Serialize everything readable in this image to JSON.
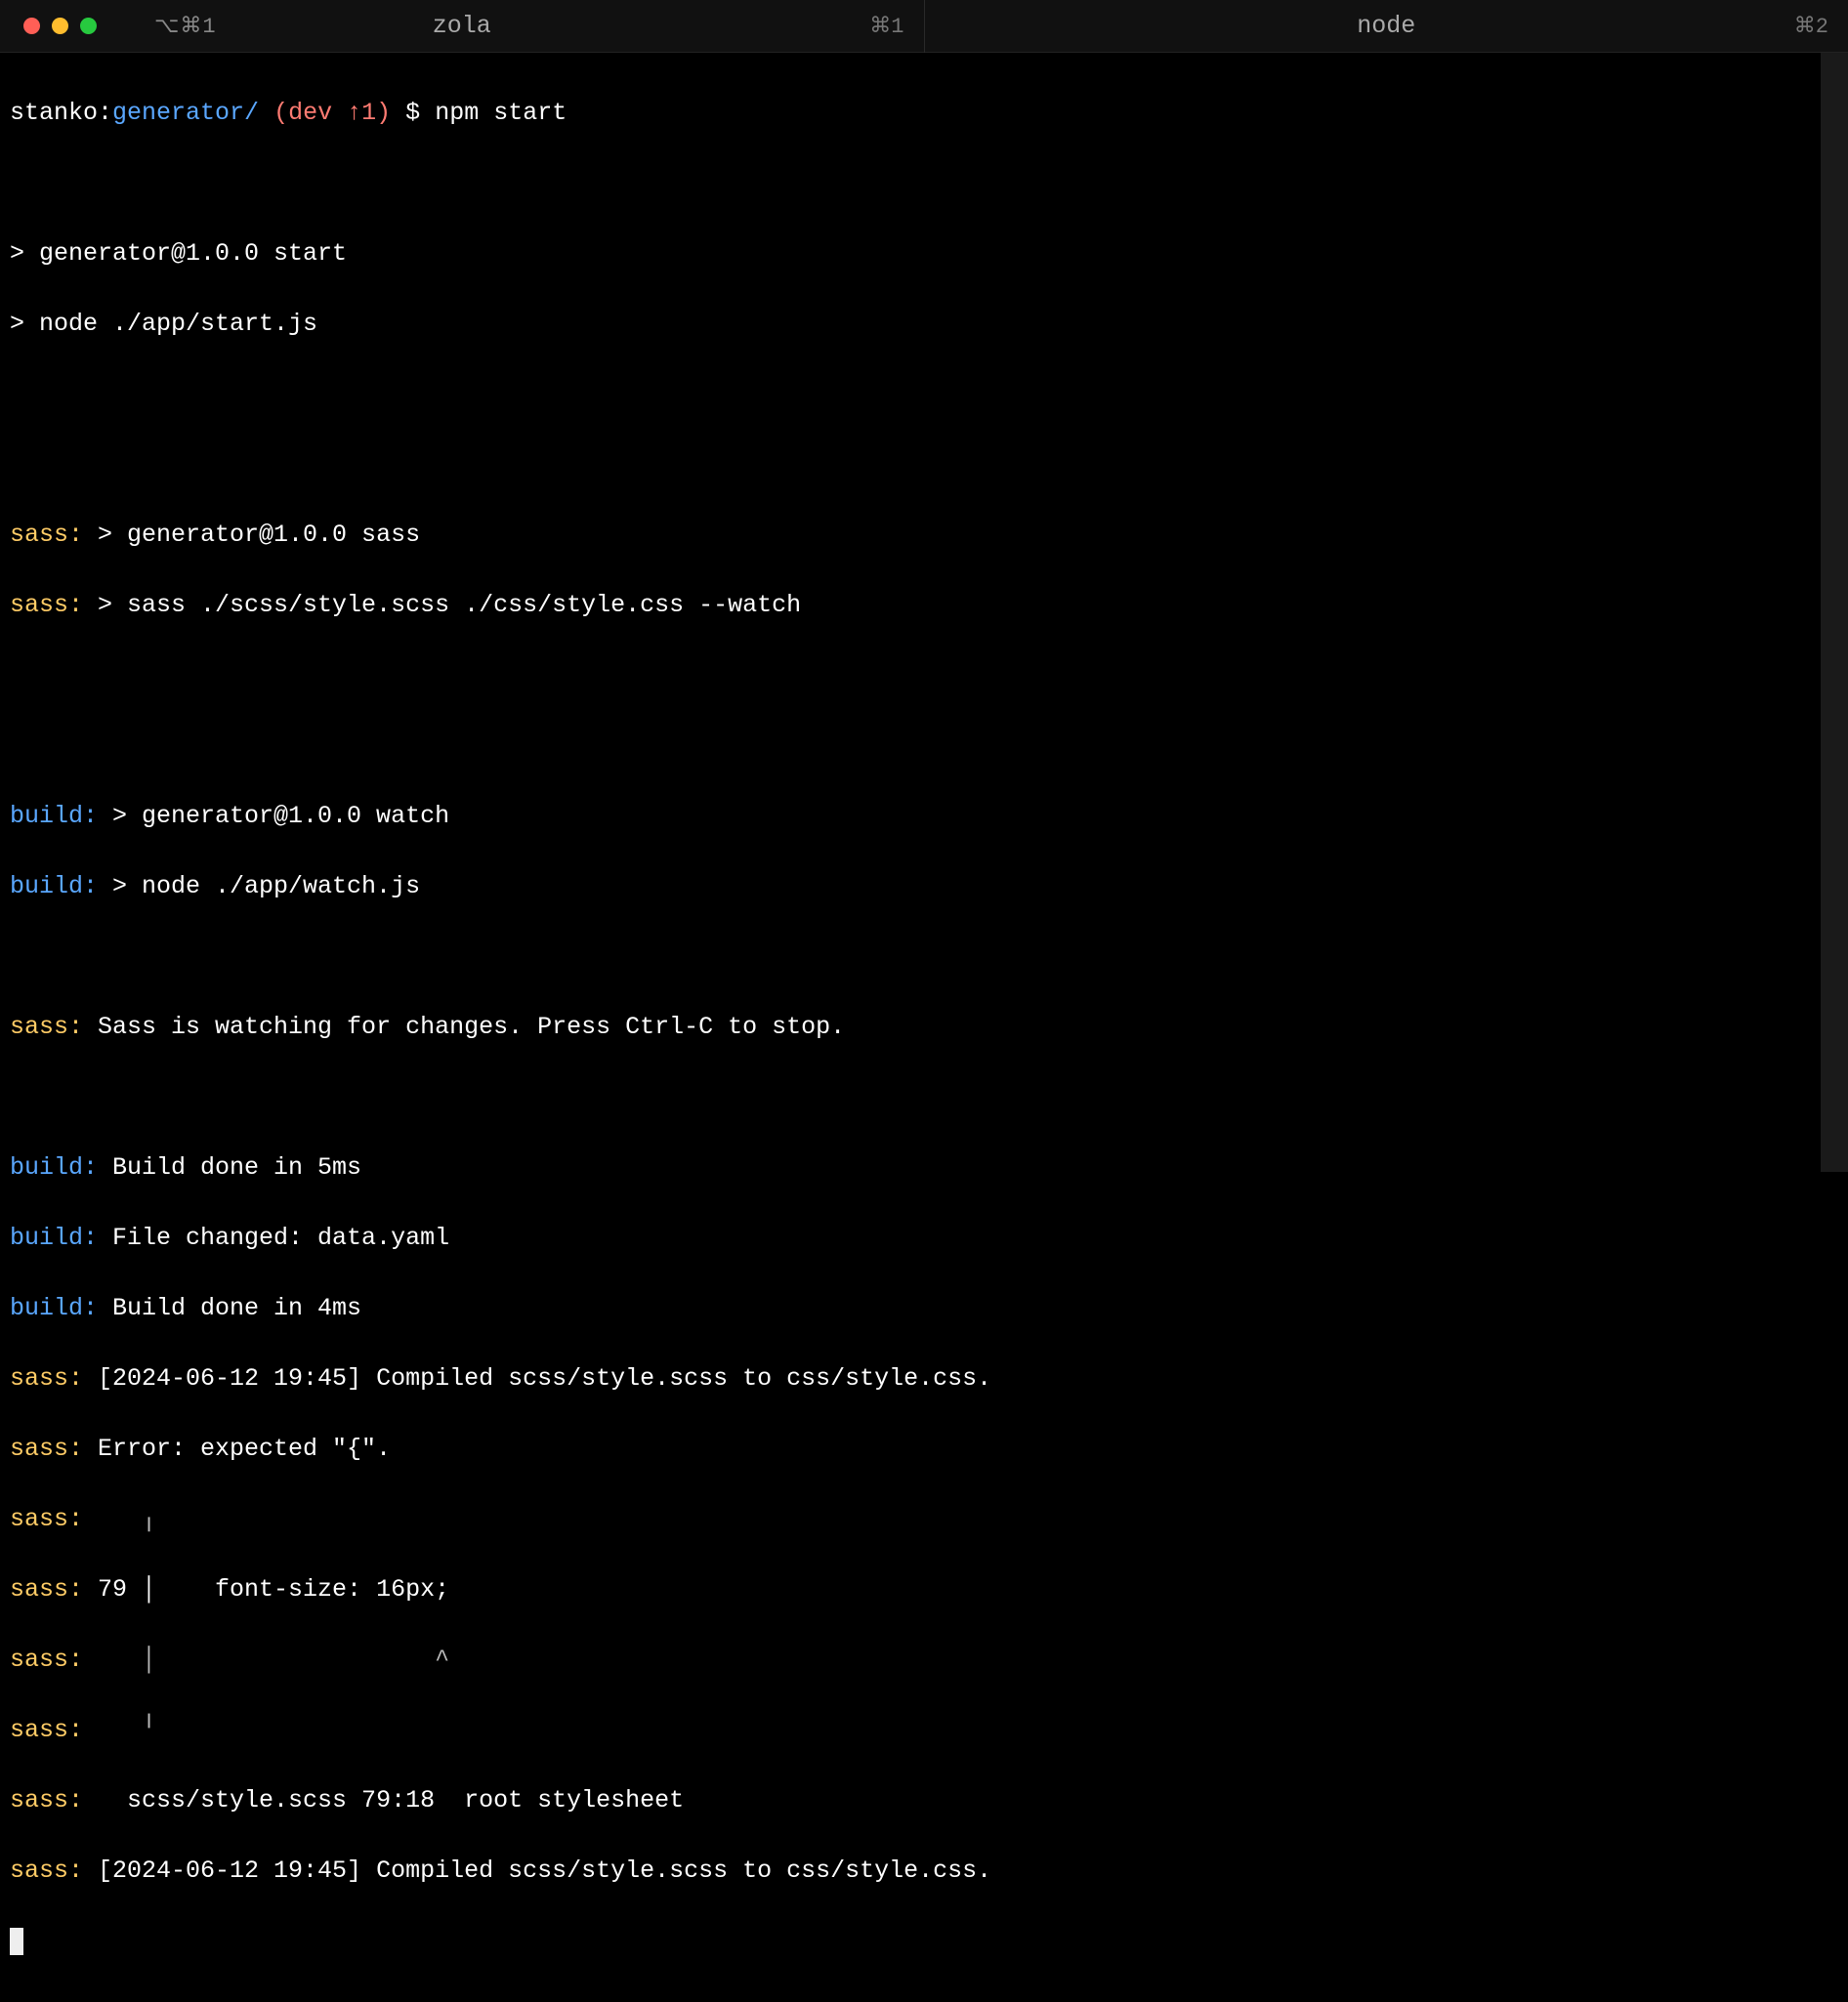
{
  "titlebar": {
    "broadcast_hint": "⌥⌘1",
    "tabs": [
      {
        "label": "zola",
        "shortcut": "⌘1"
      },
      {
        "label": "node",
        "shortcut": "⌘2"
      }
    ]
  },
  "prompt": {
    "user": "stanko",
    "cwd": "generator/",
    "branch": "dev",
    "ahead": "↑1",
    "dollar": "$",
    "command": "npm start"
  },
  "lines": {
    "npm1": "> generator@1.0.0 start",
    "npm2": "> node ./app/start.js",
    "sass_label": "sass:",
    "build_label": "build:",
    "sass1": " > generator@1.0.0 sass",
    "sass2": " > sass ./scss/style.scss ./css/style.css --watch",
    "build1": " > generator@1.0.0 watch",
    "build2": " > node ./app/watch.js",
    "sass_watch": " Sass is watching for changes. Press Ctrl-C to stop.",
    "build_done1": " Build done in 5ms",
    "build_changed": " File changed: data.yaml",
    "build_done2": " Build done in 4ms",
    "sass_compiled1": " [2024-06-12 19:45] Compiled scss/style.scss to css/style.css.",
    "sass_error": " Error: expected \"{\".",
    "sass_frame_top": "    ╷",
    "sass_frame_mid": " 79 │    font-size: 16px;",
    "sass_frame_caret": "    │                   ^",
    "sass_frame_bot": "    ╵",
    "sass_stack": "   scss/style.scss 79:18  root stylesheet",
    "sass_compiled2": " [2024-06-12 19:45] Compiled scss/style.scss to css/style.css."
  }
}
